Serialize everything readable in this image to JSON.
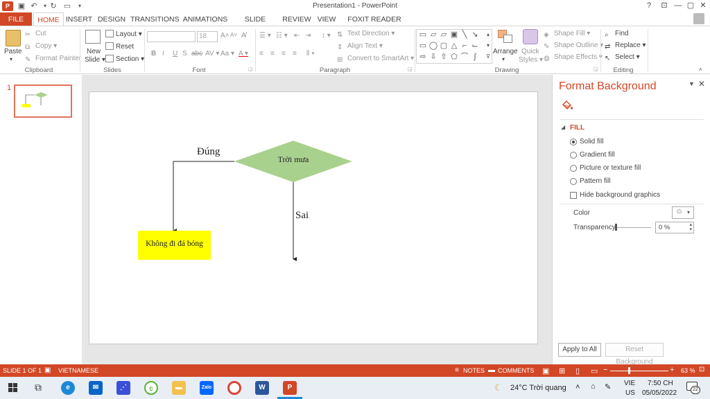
{
  "window": {
    "title": "Presentation1 - PowerPoint",
    "help": "?",
    "minimize": "—",
    "restore": "▢",
    "close": "✕"
  },
  "tabs": [
    "FILE",
    "HOME",
    "INSERT",
    "DESIGN",
    "TRANSITIONS",
    "ANIMATIONS",
    "SLIDE SHOW",
    "REVIEW",
    "VIEW",
    "FOXIT READER PDF"
  ],
  "active_tab": "HOME",
  "ribbon": {
    "clipboard": {
      "label": "Clipboard",
      "paste": "Paste",
      "cut": "Cut",
      "copy": "Copy",
      "format_painter": "Format Painter"
    },
    "slides": {
      "label": "Slides",
      "new_slide_1": "New",
      "new_slide_2": "Slide",
      "layout": "Layout",
      "reset": "Reset",
      "section": "Section"
    },
    "font": {
      "label": "Font",
      "size": "18",
      "bold": "B",
      "italic": "I",
      "underline": "U",
      "strike": "S",
      "strike2": "abc",
      "spacing": "AV",
      "case": "Aa",
      "color": "A",
      "grow": "A",
      "shrink": "A"
    },
    "paragraph": {
      "label": "Paragraph",
      "text_direction": "Text Direction",
      "align_text": "Align Text",
      "smartart": "Convert to SmartArt"
    },
    "drawing": {
      "label": "Drawing",
      "arrange": "Arrange",
      "quick_styles_1": "Quick",
      "quick_styles_2": "Styles",
      "shape_fill": "Shape Fill",
      "shape_outline": "Shape Outline",
      "shape_effects": "Shape Effects"
    },
    "editing": {
      "label": "Editing",
      "find": "Find",
      "replace": "Replace",
      "select": "Select"
    }
  },
  "thumbnail": {
    "number": "1"
  },
  "slide": {
    "decision": "Trời mưa",
    "yes_label": "Đúng",
    "no_label": "Sai",
    "outcome": "Không đi đá bóng",
    "decision_color": "#a9d18e",
    "outcome_color": "#ffff00"
  },
  "format_pane": {
    "title": "Format Background",
    "section": "FILL",
    "options": [
      "Solid fill",
      "Gradient fill",
      "Picture or texture fill",
      "Pattern fill"
    ],
    "selected_option": "Solid fill",
    "hide_bg": "Hide background graphics",
    "color_label": "Color",
    "transparency_label": "Transparency",
    "transparency_value": "0 %",
    "transparency_level": 0,
    "apply_all": "Apply to All",
    "reset_bg": "Reset Background"
  },
  "statusbar": {
    "slide_info": "SLIDE 1 OF 1",
    "language": "VIETNAMESE",
    "notes": "NOTES",
    "comments": "COMMENTS",
    "zoom": "63 %",
    "zoom_minus": "−",
    "zoom_plus": "+"
  },
  "taskbar": {
    "weather": "24°C  Trời quang",
    "lang_1": "VIE",
    "lang_2": "US",
    "time": "7:50 CH",
    "date": "05/05/2022",
    "notifications": "22",
    "zalo": "Zalo",
    "word": "W",
    "powerpoint": "P"
  },
  "colors": {
    "accent": "#d24726",
    "ribbon_bg": "#ffffff",
    "canvas_bg": "#e6e6e6"
  }
}
